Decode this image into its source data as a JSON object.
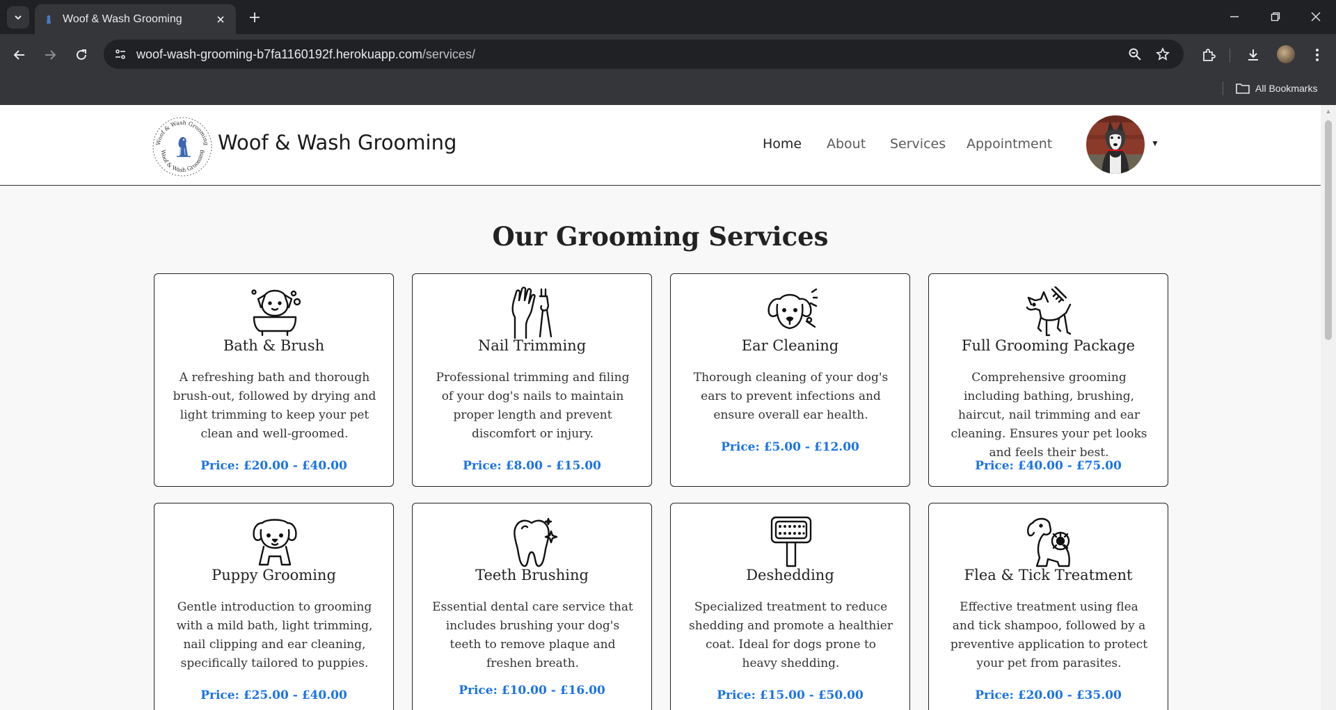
{
  "browser": {
    "tab_title": "Woof & Wash Grooming",
    "url_host": "woof-wash-grooming-b7fa1160192f.herokuapp.com",
    "url_path": "/services/",
    "bookmarks_label": "All Bookmarks"
  },
  "site": {
    "brand_name": "Woof & Wash Grooming",
    "logo_text": "Woof & Wash Grooming",
    "nav": [
      "Home",
      "About",
      "Services",
      "Appointment"
    ],
    "active_nav": "Home"
  },
  "page": {
    "title": "Our Grooming Services",
    "services": [
      {
        "title": "Bath & Brush",
        "icon": "dog-in-bath-icon",
        "description": "A refreshing bath and thorough brush-out, followed by drying and light trimming to keep your pet clean and well-groomed.",
        "price": "Price: £20.00 - £40.00"
      },
      {
        "title": "Nail Trimming",
        "icon": "paw-and-clippers-icon",
        "description": "Professional trimming and filing of your dog's nails to maintain proper length and prevent discomfort or injury.",
        "price": "Price: £8.00 - £15.00"
      },
      {
        "title": "Ear Cleaning",
        "icon": "dog-ear-icon",
        "description": "Thorough cleaning of your dog's ears to prevent infections and ensure overall ear health.",
        "price": "Price: £5.00 - £12.00"
      },
      {
        "title": "Full Grooming Package",
        "icon": "dog-with-comb-icon",
        "description": "Comprehensive grooming including bathing, brushing, haircut, nail trimming and ear cleaning. Ensures your pet looks and feels their best.",
        "price": "Price: £40.00 - £75.00"
      },
      {
        "title": "Puppy Grooming",
        "icon": "puppy-icon",
        "description": "Gentle introduction to grooming with a mild bath, light trimming, nail clipping and ear cleaning, specifically tailored to puppies.",
        "price": "Price: £25.00 - £40.00"
      },
      {
        "title": "Teeth Brushing",
        "icon": "tooth-icon",
        "description": "Essential dental care service that includes brushing your dog's teeth to remove plaque and freshen breath.",
        "price": "Price: £10.00 - £16.00"
      },
      {
        "title": "Deshedding",
        "icon": "deshedding-brush-icon",
        "description": "Specialized treatment to reduce shedding and promote a healthier coat. Ideal for dogs prone to heavy shedding.",
        "price": "Price: £15.00 - £50.00"
      },
      {
        "title": "Flea & Tick Treatment",
        "icon": "dog-with-flea-icon",
        "description": "Effective treatment using flea and tick shampoo, followed by a preventive application to protect your pet from parasites.",
        "price": "Price: £20.00 - £35.00"
      }
    ]
  },
  "colors": {
    "price": "#1a73e8",
    "chrome_dark": "#202124",
    "chrome_toolbar": "#35363a",
    "page_bg": "#f8f8f8"
  }
}
